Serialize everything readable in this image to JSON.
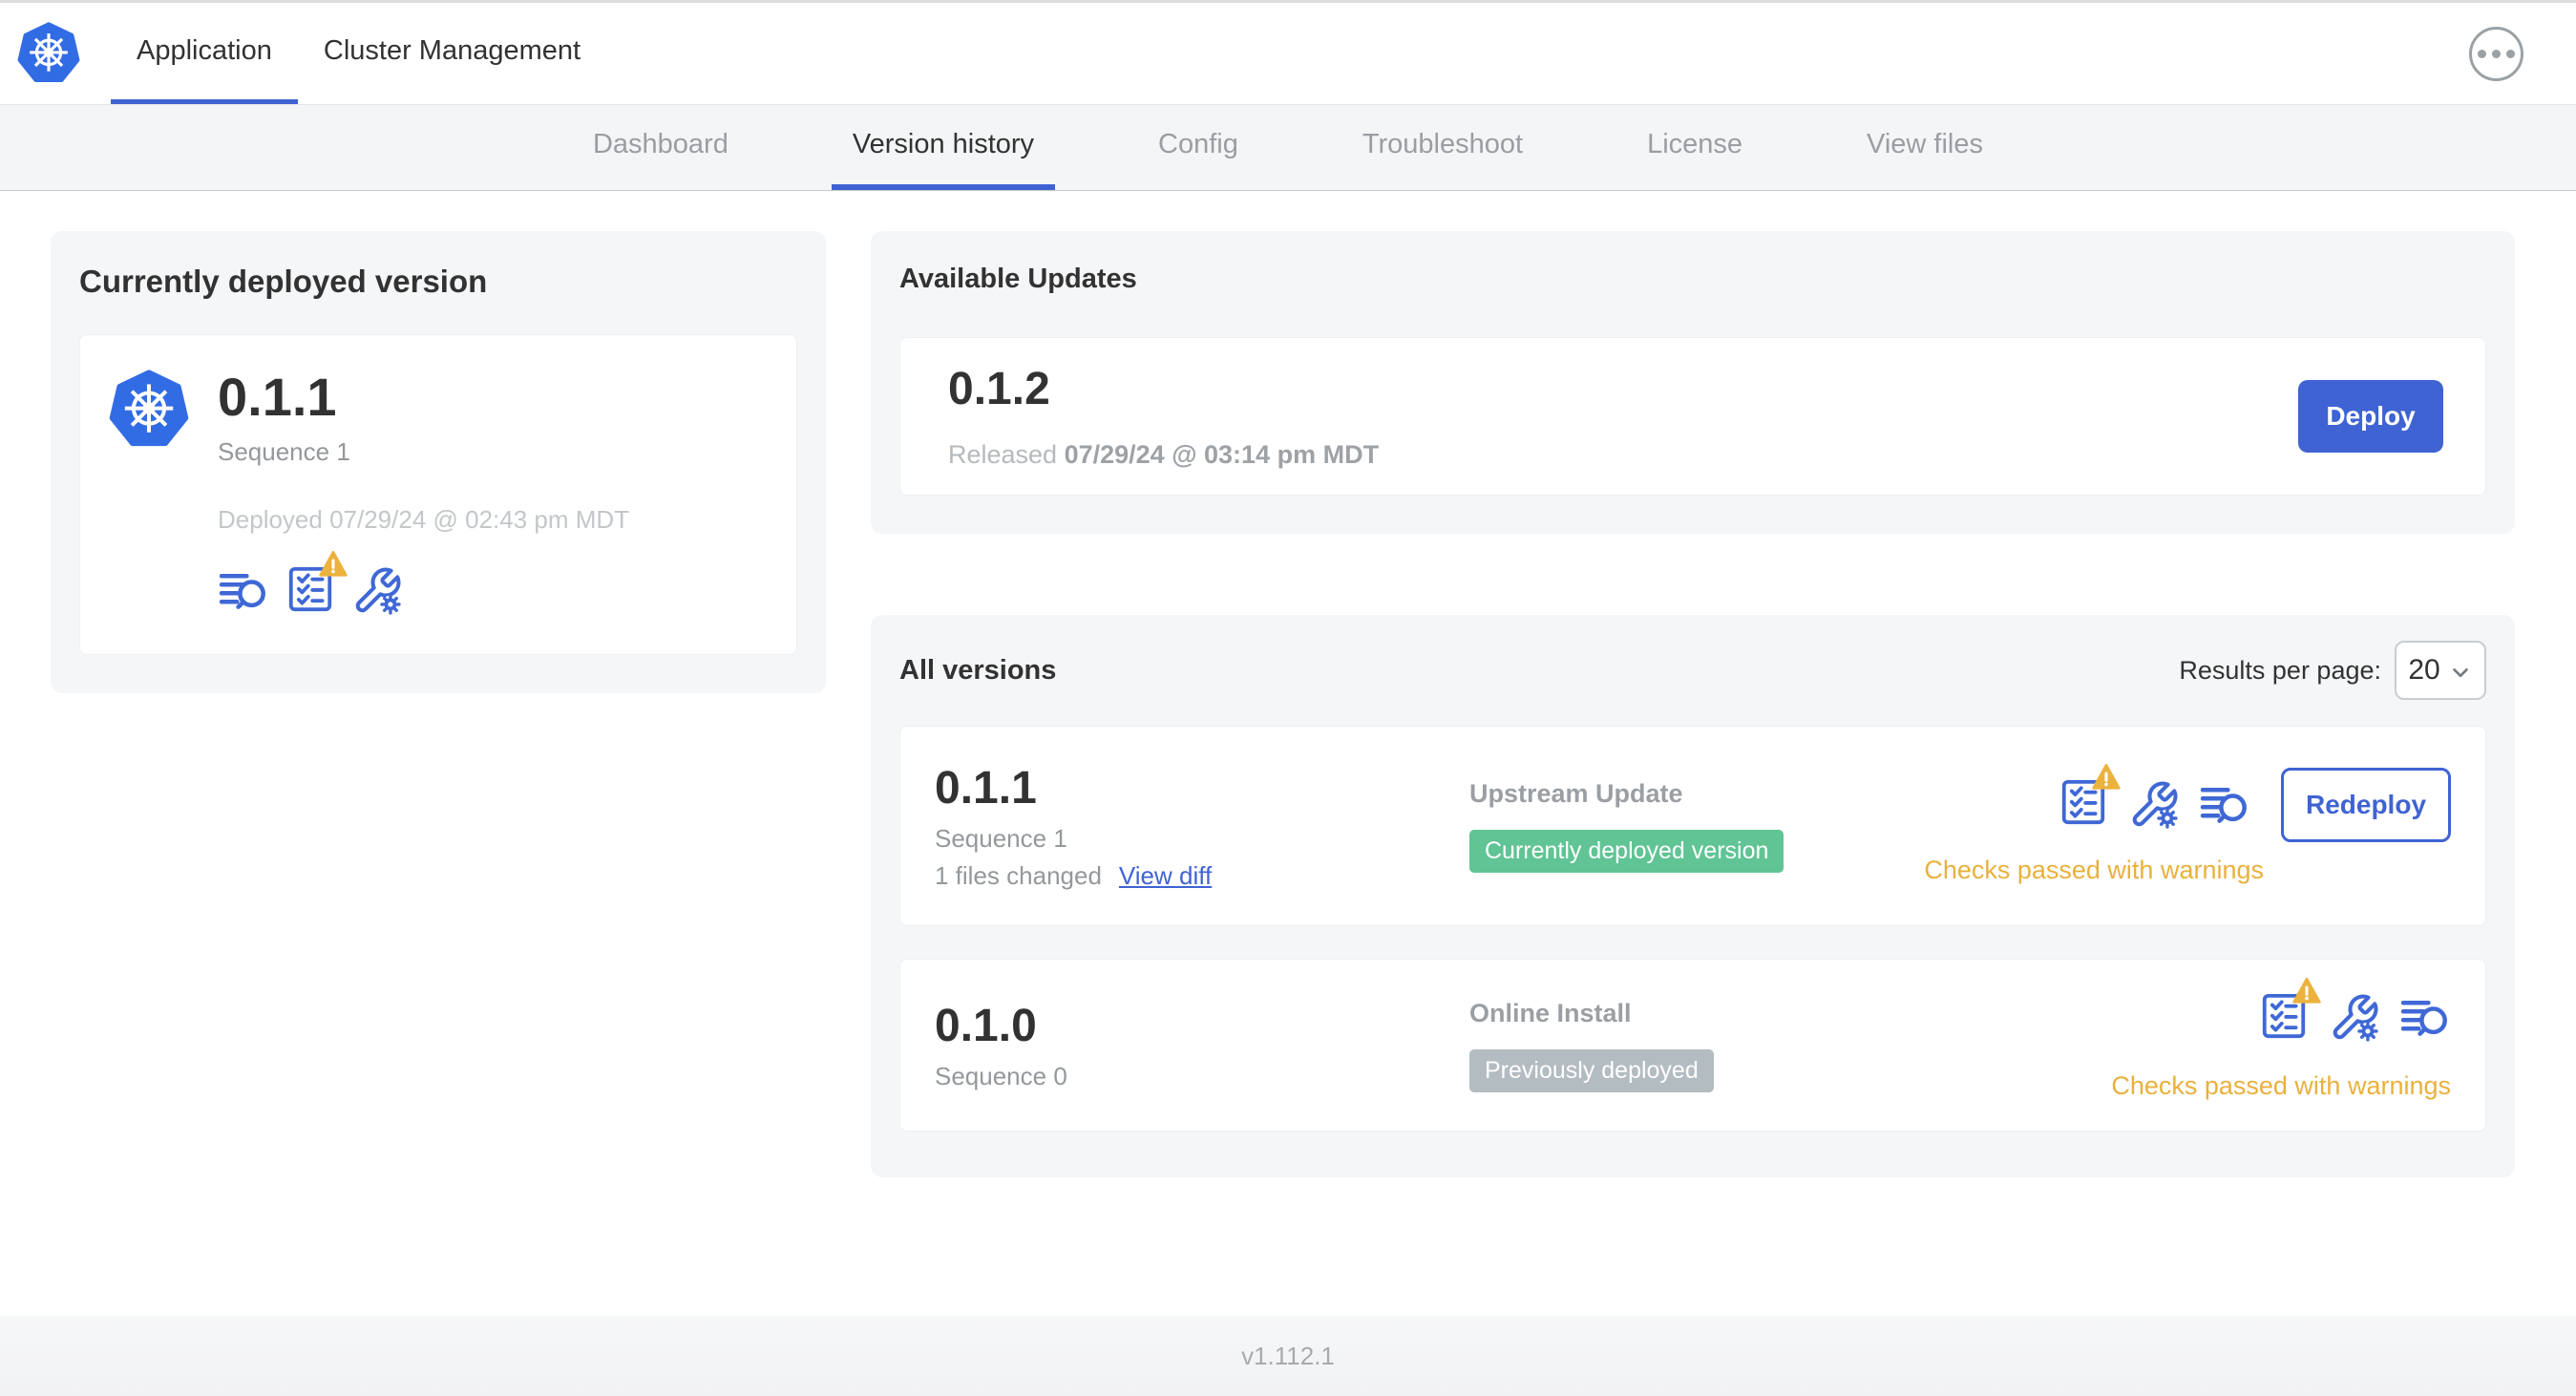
{
  "header": {
    "logo_icon": "kubernetes-logo",
    "tabs": [
      {
        "label": "Application",
        "active": true
      },
      {
        "label": "Cluster Management",
        "active": false
      }
    ],
    "menu_icon": "ellipsis-icon"
  },
  "subnav": {
    "tabs": [
      {
        "label": "Dashboard",
        "active": false
      },
      {
        "label": "Version history",
        "active": true
      },
      {
        "label": "Config",
        "active": false
      },
      {
        "label": "Troubleshoot",
        "active": false
      },
      {
        "label": "License",
        "active": false
      },
      {
        "label": "View files",
        "active": false
      }
    ]
  },
  "current_version_card": {
    "title": "Currently deployed version",
    "version": "0.1.1",
    "sequence": "Sequence 1",
    "deployed": "Deployed 07/29/24 @ 02:43 pm MDT",
    "icons": [
      "diff-icon",
      "preflight-checks-icon warning-icon",
      "config-icon"
    ]
  },
  "available_updates": {
    "title": "Available Updates",
    "version": "0.1.2",
    "released_prefix": "Released",
    "released_date": "07/29/24 @ 03:14 pm MDT",
    "deploy_label": "Deploy"
  },
  "all_versions": {
    "title": "All versions",
    "results_per_page_label": "Results per page:",
    "results_per_page_value": "20",
    "rows": [
      {
        "version": "0.1.1",
        "sequence": "Sequence 1",
        "files_changed": "1 files changed",
        "view_diff_label": "View diff",
        "source": "Upstream Update",
        "badge": "Currently deployed version",
        "badge_color": "#60c495",
        "icons": [
          "preflight-checks-icon warning-icon",
          "config-icon",
          "diff-icon"
        ],
        "checks_status": "Checks passed with warnings",
        "action_label": "Redeploy"
      },
      {
        "version": "0.1.0",
        "sequence": "Sequence 0",
        "source": "Online Install",
        "badge": "Previously deployed",
        "badge_color": "#b3bcc1",
        "icons": [
          "preflight-checks-icon warning-icon",
          "config-icon",
          "diff-icon"
        ],
        "checks_status": "Checks passed with warnings"
      }
    ]
  },
  "footer": {
    "version": "v1.112.1"
  },
  "colors": {
    "accent_blue": "#3f63d3",
    "kubernetes_blue": "#326ce5",
    "badge_green": "#60c495",
    "badge_gray": "#b3bcc1",
    "warning_amber": "#e9b13d",
    "card_gray": "#f5f6f8",
    "text_dark": "#323232",
    "text_gray": "#9b9fa3"
  }
}
